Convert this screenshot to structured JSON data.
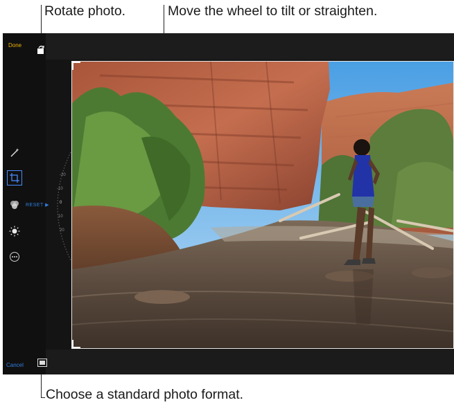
{
  "callouts": {
    "rotate": "Rotate photo.",
    "wheel": "Move the wheel to tilt or straighten.",
    "format": "Choose a standard photo format."
  },
  "toolbar": {
    "done_label": "Done",
    "cancel_label": "Cancel"
  },
  "tools": [
    {
      "icon": "magic-wand-icon"
    },
    {
      "icon": "crop-icon",
      "active": true
    },
    {
      "icon": "filters-icon"
    },
    {
      "icon": "light-adjust-icon"
    },
    {
      "icon": "more-icon"
    }
  ],
  "straighten": {
    "reset_label": "RESET",
    "ticks": [
      "-20",
      "-10",
      "0",
      "10",
      "20"
    ]
  },
  "colors": {
    "done": "#f0b400",
    "accent": "#2f7fe0",
    "background": "#141414"
  }
}
